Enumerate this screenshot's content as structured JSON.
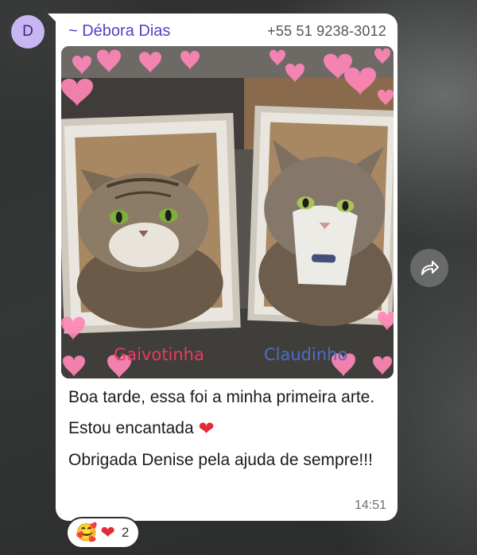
{
  "message": {
    "avatar_letter": "D",
    "sender_name": "~ Débora Dias",
    "sender_phone": "+55 51 9238-3012",
    "photo": {
      "label_left": "Gaivotinha",
      "label_right": "Claudinho"
    },
    "text_lines": [
      "Boa tarde, essa foi a minha primeira arte.",
      "Estou encantada",
      "Obrigada Denise pela ajuda de sempre!!!"
    ],
    "timestamp": "14:51",
    "reactions": {
      "emoji_1": "🥰",
      "emoji_2": "❤",
      "count": "2"
    }
  },
  "inline_emoji": "❤",
  "colors": {
    "sender_name": "#5b3cc4",
    "avatar_bg": "#c8b6f2",
    "label_left": "#e83a63",
    "label_right": "#4a6fc4",
    "bubble": "#ffffff",
    "wallpaper": "#2d2f2e"
  },
  "icons": {
    "forward": "forward-arrow-icon",
    "hearts_decoration": "heart-icon"
  }
}
